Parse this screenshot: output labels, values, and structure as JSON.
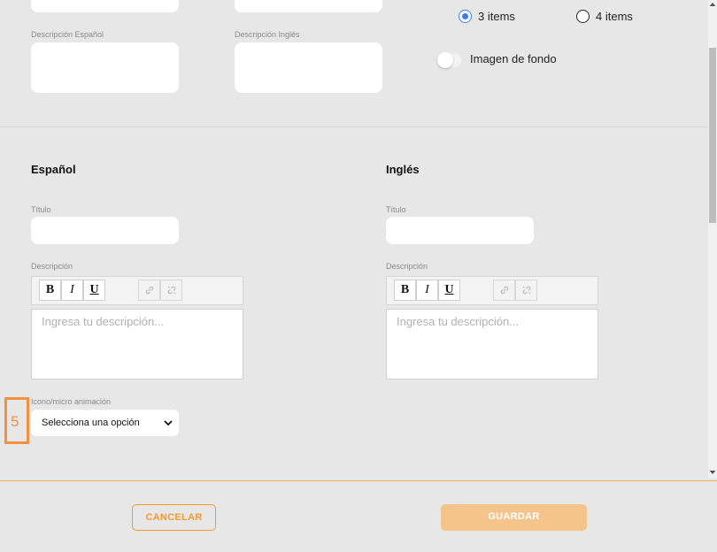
{
  "top": {
    "desc_es_label": "Descripción Español",
    "desc_en_label": "Descripción Inglés",
    "radio_3": "3 items",
    "radio_4": "4 items",
    "toggle_label": "Imagen de fondo"
  },
  "spanish": {
    "heading": "Español",
    "title_label": "Título",
    "desc_label": "Descripción",
    "placeholder": "Ingresa tu descripción...",
    "icon_label": "Icono/micro animación",
    "select_value": "Selecciona una opción"
  },
  "english": {
    "heading": "Inglés",
    "title_label": "Título",
    "desc_label": "Descripción",
    "placeholder": "Ingresa tu descripción..."
  },
  "toolbar": {
    "bold": "B",
    "italic": "I",
    "underline": "U",
    "link_icon": "link-icon",
    "unlink_icon": "unlink-icon"
  },
  "badge": "5",
  "footer": {
    "cancel": "CANCELAR",
    "save": "GUARDAR"
  },
  "colors": {
    "accent": "#f39a2a",
    "radio_on": "#3d7de8",
    "save_disabled": "#f4c48b",
    "badge": "#f39140"
  }
}
